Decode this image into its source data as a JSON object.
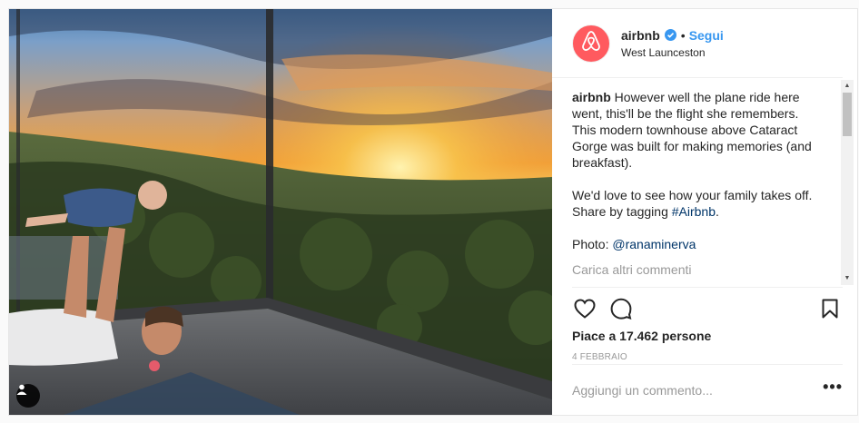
{
  "post": {
    "account": {
      "username": "airbnb",
      "verified": true,
      "follow_label": "Segui",
      "separator": "•",
      "location": "West Launceston",
      "avatar_icon": "airbnb-logo-icon",
      "brand_color": "#ff5a5f"
    },
    "caption": {
      "username": "airbnb",
      "text": "However well the plane ride here went, this'll be the flight she remembers. This modern townhouse above Cataract Gorge was built for making memories (and breakfast).",
      "text2_prefix": "We'd love to see how your family takes off. Share by tagging ",
      "hashtag": "#Airbnb",
      "text2_suffix": ".",
      "photo_prefix": "Photo: ",
      "photo_mention": "@ranaminerva"
    },
    "load_more_label": "Carica altri commenti",
    "likes_label": "Piace a 17.462 persone",
    "date_label": "4 FEBBRAIO",
    "comment_placeholder": "Aggiungi un commento...",
    "more_options": "•••",
    "link_color": "#003569",
    "follow_color": "#3897f0"
  }
}
